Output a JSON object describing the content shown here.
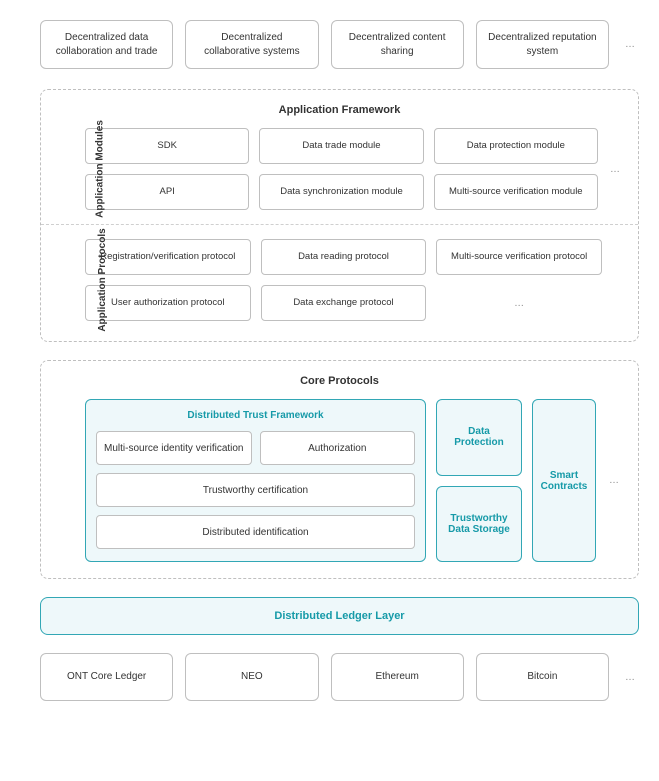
{
  "topRow": {
    "items": [
      "Decentralized data collaboration and trade",
      "Decentralized collaborative systems",
      "Decentralized content sharing",
      "Decentralized reputation system"
    ],
    "ellipsis": "…"
  },
  "appFramework": {
    "title": "Application Framework",
    "modules": {
      "label": "Application Modules",
      "row1": [
        "SDK",
        "Data trade module",
        "Data protection module"
      ],
      "row2": [
        "API",
        "Data synchronization module",
        "Multi-source verification module"
      ],
      "ellipsis": "…"
    },
    "protocols": {
      "label": "Application Protocols",
      "row1": [
        "Registration/verification protocol",
        "Data reading protocol",
        "Multi-source verification protocol"
      ],
      "row2": [
        "User authorization protocol",
        "Data exchange protocol"
      ],
      "ellipsis": "…"
    }
  },
  "coreProtocols": {
    "title": "Core Protocols",
    "dtf": {
      "title": "Distributed Trust Framework",
      "items": {
        "msiv": "Multi-source identity verification",
        "auth": "Authorization",
        "tc": "Trustworthy certification",
        "di": "Distributed identification"
      }
    },
    "mid": {
      "dataProtection": "Data Protection",
      "tds": "Trustworthy Data Storage"
    },
    "smartContracts": "Smart Contracts",
    "ellipsis": "…"
  },
  "ledgerLayer": "Distributed Ledger Layer",
  "bottomRow": {
    "items": [
      "ONT Core Ledger",
      "NEO",
      "Ethereum",
      "Bitcoin"
    ],
    "ellipsis": "…"
  }
}
